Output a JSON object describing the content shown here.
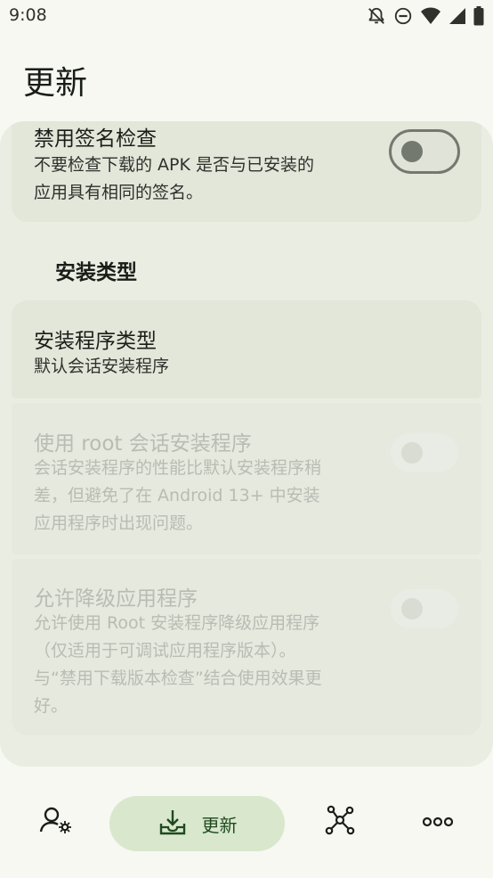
{
  "status": {
    "time": "9:08"
  },
  "header": {
    "title": "更新"
  },
  "prefs": {
    "disable_signature": {
      "title": "禁用签名检查",
      "subtitle_line1": "不要检查下载的 APK 是否与已安装的",
      "subtitle_line2": "应用具有相同的签名。",
      "enabled": false
    },
    "section_install_type": "安装类型",
    "installer_type": {
      "title": "安装程序类型",
      "value": "默认会话安装程序"
    },
    "root_session": {
      "title": "使用 root 会话安装程序",
      "subtitle_line1": "会话安装程序的性能比默认安装程序稍",
      "subtitle_line2": "差，但避免了在 Android 13+ 中安装",
      "subtitle_line3": "应用程序时出现问题。",
      "enabled": false
    },
    "allow_downgrade": {
      "title": "允许降级应用程序",
      "subtitle_line1": "允许使用 Root 安装程序降级应用程序",
      "subtitle_line2": "（仅适用于可调试应用程序版本）。",
      "subtitle_line3": "与“禁用下载版本检查”结合使用效果更",
      "subtitle_line4": "好。",
      "enabled": false
    }
  },
  "bottom_nav": {
    "items": [
      {
        "icon": "account-settings-icon"
      },
      {
        "icon": "download-tray-icon",
        "label": "更新",
        "active": true
      },
      {
        "icon": "network-graph-icon"
      },
      {
        "icon": "more-horizontal-icon"
      }
    ]
  },
  "colors": {
    "background": "#f6f8f1",
    "group_card": "#e9ede2",
    "item_card": "#e2e7da",
    "nav_active": "#d9e7cd",
    "disabled_text": "#b8bcb3"
  }
}
